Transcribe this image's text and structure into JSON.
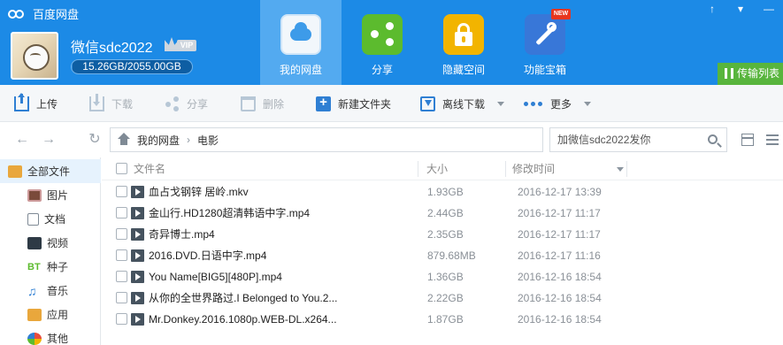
{
  "app": {
    "title": "百度网盘",
    "window_controls": [
      "↑",
      "▾",
      "—"
    ]
  },
  "user": {
    "name": "微信sdc2022",
    "vip_label": "VIP",
    "quota_text": "15.26GB/2055.00GB",
    "quota_fraction": 0.0074
  },
  "nav": [
    {
      "label": "我的网盘",
      "icon": "cloud-disk-icon",
      "active": true
    },
    {
      "label": "分享",
      "icon": "share-icon",
      "active": false
    },
    {
      "label": "隐藏空间",
      "icon": "lock-icon",
      "active": false
    },
    {
      "label": "功能宝箱",
      "icon": "toolbox-icon",
      "active": false,
      "badge": "NEW"
    }
  ],
  "transfer_label": "传输列表",
  "toolbar": {
    "upload": "上传",
    "download": "下载",
    "share": "分享",
    "delete": "删除",
    "new_folder": "新建文件夹",
    "offline_download": "离线下载",
    "more": "更多"
  },
  "breadcrumb": {
    "root": "我的网盘",
    "separator": "›",
    "current": "电影"
  },
  "search": {
    "value": "加微信sdc2022发你"
  },
  "sidebar": {
    "items": [
      {
        "label": "全部文件",
        "icon": "folder-icon",
        "active": true
      },
      {
        "label": "图片",
        "icon": "image-icon"
      },
      {
        "label": "文档",
        "icon": "document-icon"
      },
      {
        "label": "视频",
        "icon": "video-icon"
      },
      {
        "label": "种子",
        "icon": "bt-icon",
        "icon_text": "BT"
      },
      {
        "label": "音乐",
        "icon": "music-icon"
      },
      {
        "label": "应用",
        "icon": "app-icon"
      },
      {
        "label": "其他",
        "icon": "other-icon"
      }
    ]
  },
  "table": {
    "headers": {
      "name": "文件名",
      "size": "大小",
      "modified": "修改时间"
    },
    "rows": [
      {
        "name": "血占戈钢锌 居岭.mkv",
        "size": "1.93GB",
        "modified": "2016-12-17 13:39"
      },
      {
        "name": "金山行.HD1280超清韩语中字.mp4",
        "size": "2.44GB",
        "modified": "2016-12-17 11:17"
      },
      {
        "name": "奇异博士.mp4",
        "size": "2.35GB",
        "modified": "2016-12-17 11:17"
      },
      {
        "name": "2016.DVD.日语中字.mp4",
        "size": "879.68MB",
        "modified": "2016-12-17 11:16"
      },
      {
        "name": "You Name[BIG5][480P].mp4",
        "size": "1.36GB",
        "modified": "2016-12-16 18:54"
      },
      {
        "name": "从你的全世界路过.I Belonged to You.2...",
        "size": "2.22GB",
        "modified": "2016-12-16 18:54"
      },
      {
        "name": "Mr.Donkey.2016.1080p.WEB-DL.x264...",
        "size": "1.87GB",
        "modified": "2016-12-16 18:54"
      }
    ]
  },
  "colors": {
    "header_bg": "#1c8ae6",
    "nav_active_bg": "#53aaf0",
    "transfer_bg": "#58b53d",
    "accent": "#2f7fd3"
  }
}
